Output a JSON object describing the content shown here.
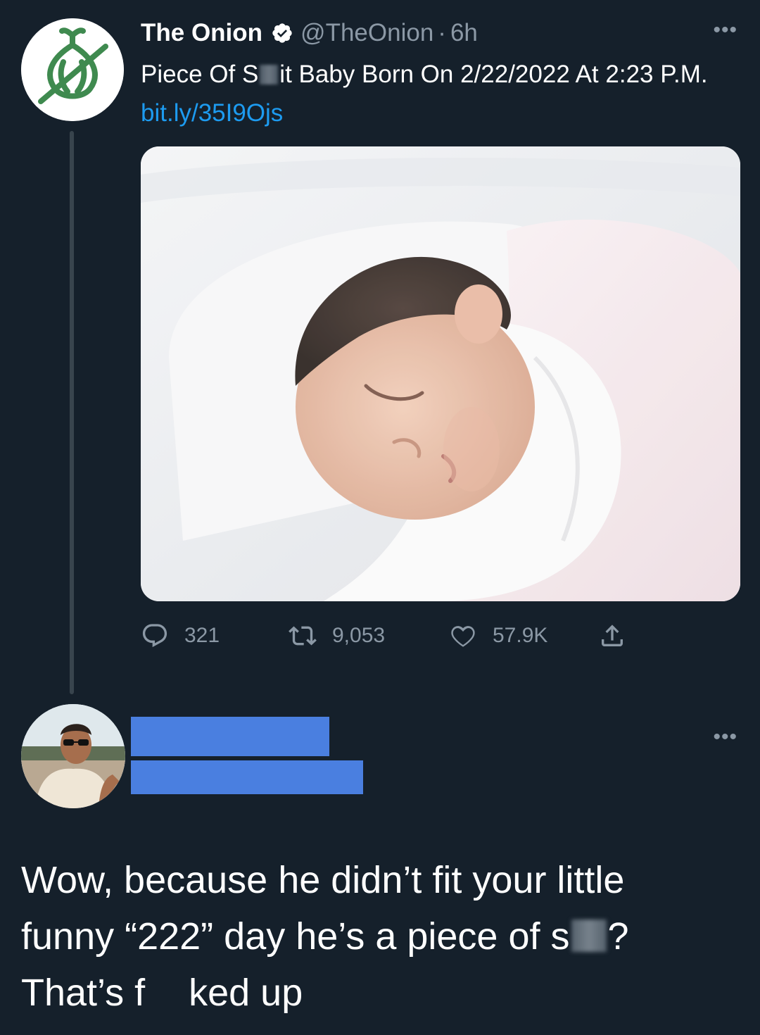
{
  "tweet": {
    "author_name": "The Onion",
    "handle": "@TheOnion",
    "separator": "·",
    "time": "6h",
    "more_label": "•••",
    "text_part1": "Piece Of S",
    "text_part2": "it Baby Born On 2/22/2022 At 2:23 P.M. ",
    "link": "bit.ly/35I9Ojs",
    "stats": {
      "replies": "321",
      "retweets": "9,053",
      "likes": "57.9K"
    }
  },
  "reply": {
    "more_label": "•••",
    "line1": "Wow, because he didn’t fit your little",
    "line2_part1": "funny “222” day he’s a piece of s",
    "line2_part2": "?",
    "line3_part1": "That’s f",
    "line3_part2": "ked up"
  },
  "colors": {
    "background": "#15202b",
    "link": "#1d9bf0",
    "secondary_text": "#8b98a5",
    "onion_green": "#3f8a4f",
    "redaction_blue": "#4a7fe0"
  },
  "icons": {
    "verified": "verified-badge-icon",
    "reply": "reply-bubble-icon",
    "retweet": "retweet-icon",
    "like": "heart-icon",
    "share": "share-icon",
    "more": "more-dots-icon"
  }
}
